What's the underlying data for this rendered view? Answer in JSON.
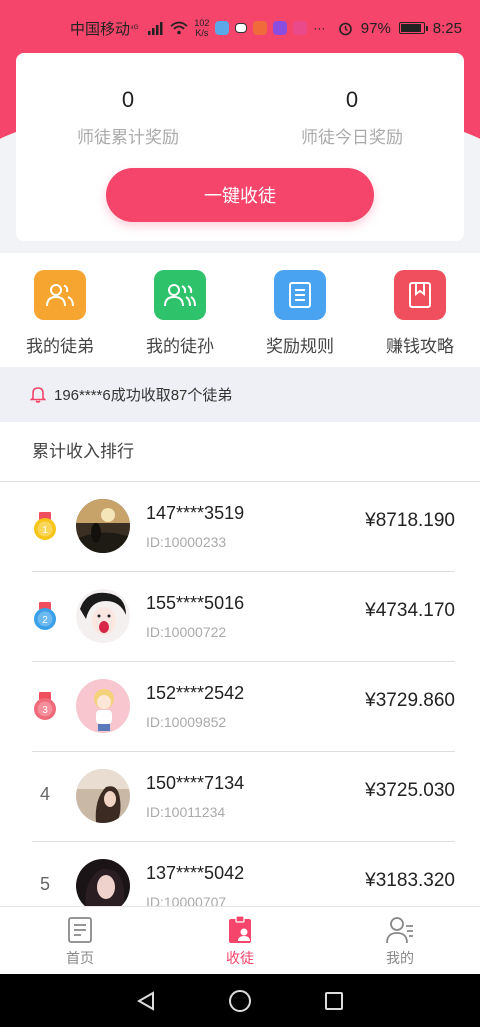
{
  "status_bar": {
    "carrier": "中国移动",
    "network": "⁴ᴳ",
    "speed_top": "102",
    "speed_bottom": "K/s",
    "battery": "97%",
    "time": "8:25"
  },
  "summary": {
    "total_reward_value": "0",
    "total_reward_label": "师徒累计奖励",
    "today_reward_value": "0",
    "today_reward_label": "师徒今日奖励",
    "cta_label": "一键收徒"
  },
  "quick_nav": [
    {
      "label": "我的徒弟",
      "icon": "people-icon",
      "color": "#f7a531"
    },
    {
      "label": "我的徒孙",
      "icon": "group-icon",
      "color": "#2ec36a"
    },
    {
      "label": "奖励规则",
      "icon": "document-icon",
      "color": "#4aa3f0"
    },
    {
      "label": "赚钱攻略",
      "icon": "bookmark-icon",
      "color": "#f0505d"
    }
  ],
  "notice": {
    "icon": "bell-icon",
    "text": "196****6成功收取87个徒弟"
  },
  "ranking": {
    "title": "累计收入排行",
    "rows": [
      {
        "rank": "1",
        "medal_color": "#f5c518",
        "name": "147****3519",
        "uid": "ID:10000233",
        "amount": "¥8718.190"
      },
      {
        "rank": "2",
        "medal_color": "#3aa0e8",
        "name": "155****5016",
        "uid": "ID:10000722",
        "amount": "¥4734.170"
      },
      {
        "rank": "3",
        "medal_color": "#f06a7a",
        "name": "152****2542",
        "uid": "ID:10009852",
        "amount": "¥3729.860"
      },
      {
        "rank": "4",
        "name": "150****7134",
        "uid": "ID:10011234",
        "amount": "¥3725.030"
      },
      {
        "rank": "5",
        "name": "137****5042",
        "uid": "ID:10000707",
        "amount": "¥3183.320"
      }
    ]
  },
  "tabbar": [
    {
      "label": "首页",
      "icon": "home-doc-icon",
      "active": false
    },
    {
      "label": "收徒",
      "icon": "recruit-icon",
      "active": true
    },
    {
      "label": "我的",
      "icon": "profile-icon",
      "active": false
    }
  ],
  "colors": {
    "accent": "#f5456a"
  }
}
